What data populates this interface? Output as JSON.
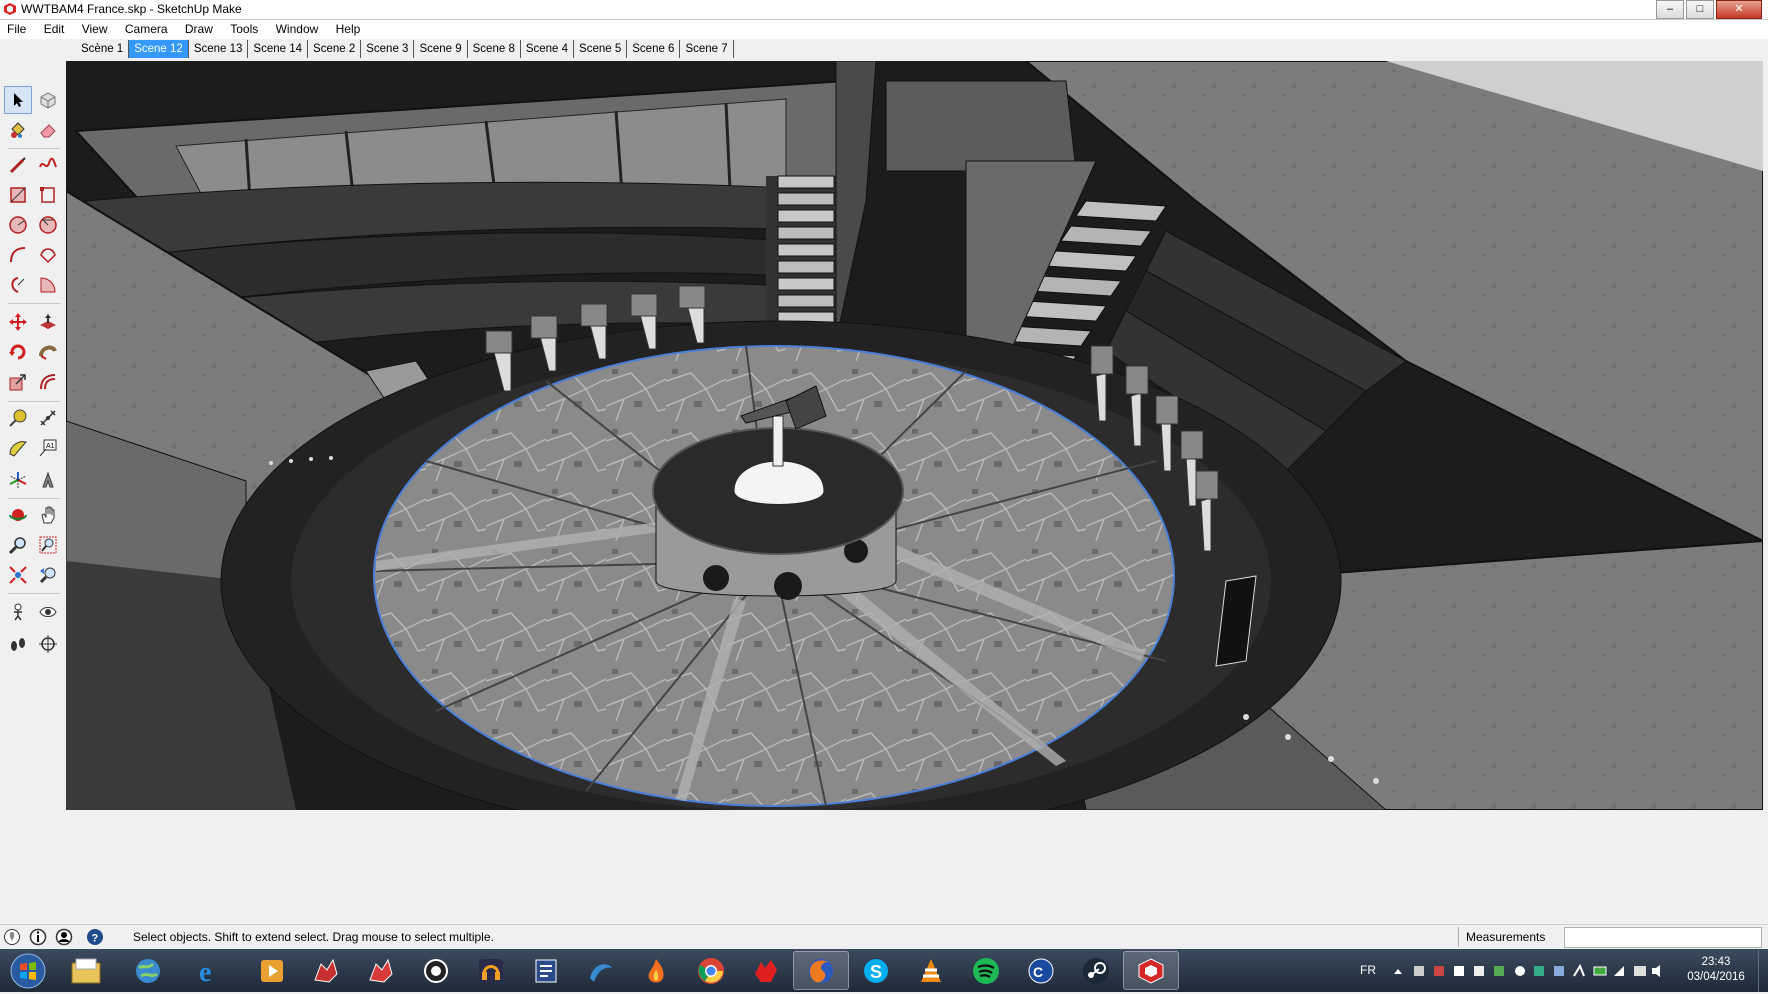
{
  "window": {
    "title": "WWTBAM4 France.skp - SketchUp Make",
    "minimize": "–",
    "maximize": "□",
    "close": "✕"
  },
  "menu": [
    "File",
    "Edit",
    "View",
    "Camera",
    "Draw",
    "Tools",
    "Window",
    "Help"
  ],
  "scene_tabs": [
    {
      "label": "Scène 1",
      "active": false
    },
    {
      "label": "Scene 12",
      "active": true
    },
    {
      "label": "Scene 13",
      "active": false
    },
    {
      "label": "Scene 14",
      "active": false
    },
    {
      "label": "Scene 2",
      "active": false
    },
    {
      "label": "Scene 3",
      "active": false
    },
    {
      "label": "Scene 9",
      "active": false
    },
    {
      "label": "Scene 8",
      "active": false
    },
    {
      "label": "Scene 4",
      "active": false
    },
    {
      "label": "Scene 5",
      "active": false
    },
    {
      "label": "Scene 6",
      "active": false
    },
    {
      "label": "Scene 7",
      "active": false
    }
  ],
  "tools": [
    "select-icon",
    "make-component-icon",
    "paint-bucket-icon",
    "eraser-icon",
    "line-icon",
    "freehand-icon",
    "rectangle-icon",
    "rotated-rectangle-icon",
    "circle-icon",
    "polygon-icon",
    "arc-icon",
    "two-point-arc-icon",
    "three-point-arc-icon",
    "pie-icon",
    "move-icon",
    "push-pull-icon",
    "rotate-icon",
    "follow-me-icon",
    "scale-icon",
    "offset-icon",
    "tape-measure-icon",
    "dimension-icon",
    "protractor-icon",
    "text-icon",
    "axes-icon",
    "3d-text-icon",
    "orbit-icon",
    "pan-icon",
    "zoom-icon",
    "zoom-window-icon",
    "zoom-extents-icon",
    "previous-view-icon",
    "position-camera-icon",
    "look-around-icon",
    "walk-icon",
    "section-plane-icon"
  ],
  "status": {
    "text": "Select objects. Shift to extend select. Drag mouse to select multiple.",
    "measurements_label": "Measurements"
  },
  "taskbar": {
    "apps": [
      "windows-explorer-icon",
      "browser-globe-icon",
      "internet-explorer-icon",
      "media-player-icon",
      "game-dragon-icon",
      "game-dragon-2-icon",
      "settings-gear-icon",
      "headset-icon",
      "notes-icon",
      "sketch-app-icon",
      "fire-app-icon",
      "chrome-icon",
      "red-bird-icon",
      "firefox-icon",
      "skype-icon",
      "vlc-icon",
      "spotify-icon",
      "ccleaner-icon",
      "steam-icon",
      "sketchup-icon"
    ],
    "language": "FR",
    "time": "23:43",
    "date": "03/04/2016"
  },
  "colors": {
    "selection_blue": "#3399ff",
    "sketchup_red": "#c8202a",
    "taskbar": "#2b3646"
  }
}
